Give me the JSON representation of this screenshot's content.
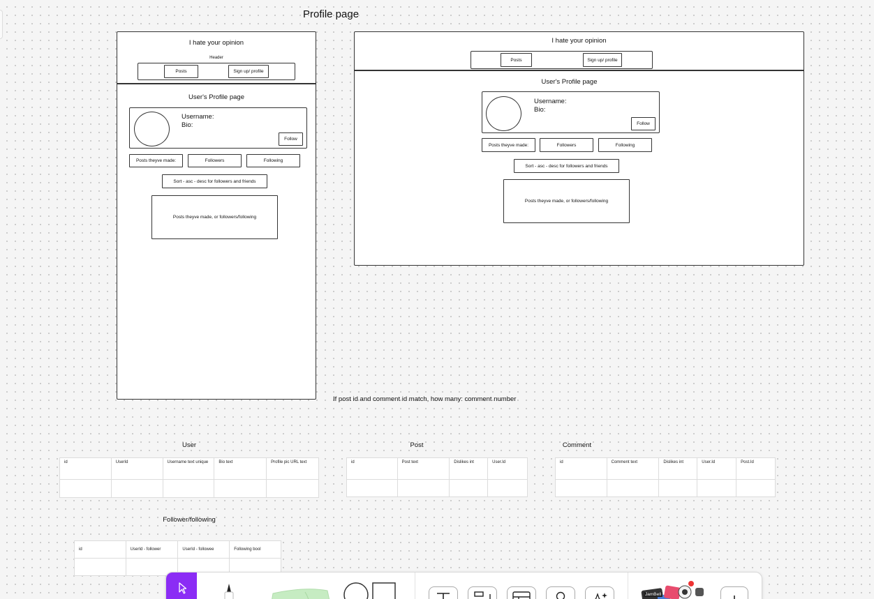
{
  "canvas": {
    "page_title": "Profile page",
    "note": "If post id and comment id match, how many: comment number"
  },
  "mobile": {
    "site_title": "I hate your opinion",
    "header_label": "Header",
    "posts_button": "Posts",
    "signup_button": "Sign up/ profile",
    "profile_heading": "User's Profile page",
    "username_label": "Username:",
    "bio_label": "Bio:",
    "follow_button": "Follow",
    "tabs": [
      "Posts theyve made:",
      "Followers",
      "Following"
    ],
    "sort_label": "Sort - asc - desc for followers and friends",
    "content_label": "Posts theyve made, or followers/following"
  },
  "desktop": {
    "site_title": "I hate your opinion",
    "posts_button": "Posts",
    "signup_button": "Sign up/ profile",
    "profile_heading": "User's Profile page",
    "username_label": "Username:",
    "bio_label": "Bio:",
    "follow_button": "Follow",
    "tabs": [
      "Posts theyve made:",
      "Followers",
      "Following"
    ],
    "sort_label": "Sort - asc - desc for followers and friends",
    "content_label": "Posts theyve made, or followers/following"
  },
  "tables": {
    "user": {
      "title": "User",
      "columns": [
        "id",
        "UserId",
        "Username text unique",
        "Bio text",
        "Profile pic URL text"
      ]
    },
    "post": {
      "title": "Post",
      "columns": [
        "id",
        "Post text",
        "Dislikes int",
        "User.Id"
      ]
    },
    "comment": {
      "title": "Comment",
      "columns": [
        "id",
        "Comment text",
        "Dislikes int",
        "User.Id",
        "Post.Id"
      ]
    },
    "follow": {
      "title": "Follower/following",
      "columns": [
        "id",
        "UserId - follower",
        "UserId - followee",
        "Following bool"
      ]
    }
  },
  "toolbar": {
    "accent_color": "#8b2cf5",
    "avatar_label": "JamBell",
    "tools": [
      "cursor-icon",
      "marker-icon",
      "sticky-note-icon",
      "shape-icon",
      "text-icon",
      "section-icon",
      "table-icon",
      "stamp-icon",
      "sparkle-icon",
      "widgets-icon",
      "plus-icon"
    ]
  }
}
